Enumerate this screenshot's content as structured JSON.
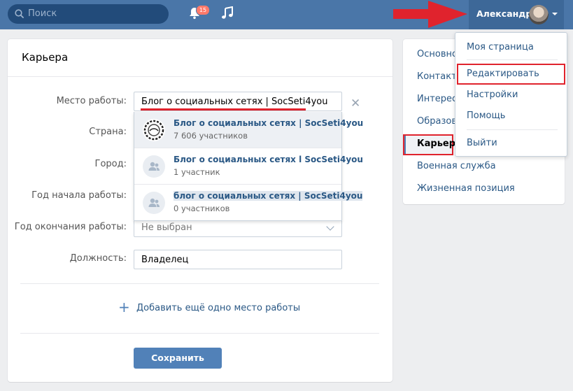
{
  "header": {
    "search_placeholder": "Поиск",
    "notifications_count": "15",
    "user_name": "Александр"
  },
  "card": {
    "title": "Карьера",
    "labels": {
      "workplace": "Место работы:",
      "country": "Страна:",
      "city": "Город:",
      "start_year": "Год начала работы:",
      "end_year": "Год окончания работы:",
      "position": "Должность:"
    },
    "workplace_value": "Блог о социальных сетях | SocSeti4you",
    "end_year_value": "Не выбран",
    "position_value": "Владелец",
    "suggestions": [
      {
        "name": "Блог о социальных сетях | SocSeti4you",
        "members": "7 606 участников"
      },
      {
        "name": "Блог о социальных сетях l SocSeti4you",
        "members": "1 участник"
      },
      {
        "name": "блог о социальных сетях | SocSeti4you",
        "members": "0 участников"
      }
    ],
    "add_link": "Добавить ещё одно место работы",
    "save_label": "Сохранить"
  },
  "sidebar": {
    "items": [
      "Основное",
      "Контакты",
      "Интересы",
      "Образование",
      "Карьера",
      "Военная служба",
      "Жизненная позиция"
    ],
    "active": "Карьера"
  },
  "profile_menu": {
    "items": [
      "Моя страница",
      "Редактировать",
      "Настройки",
      "Помощь",
      "Выйти"
    ],
    "highlighted": "Редактировать"
  },
  "colors": {
    "header_bg": "#4a76a8",
    "link": "#2a5885",
    "button": "#5181b8",
    "annotation_red": "#e0232d"
  }
}
